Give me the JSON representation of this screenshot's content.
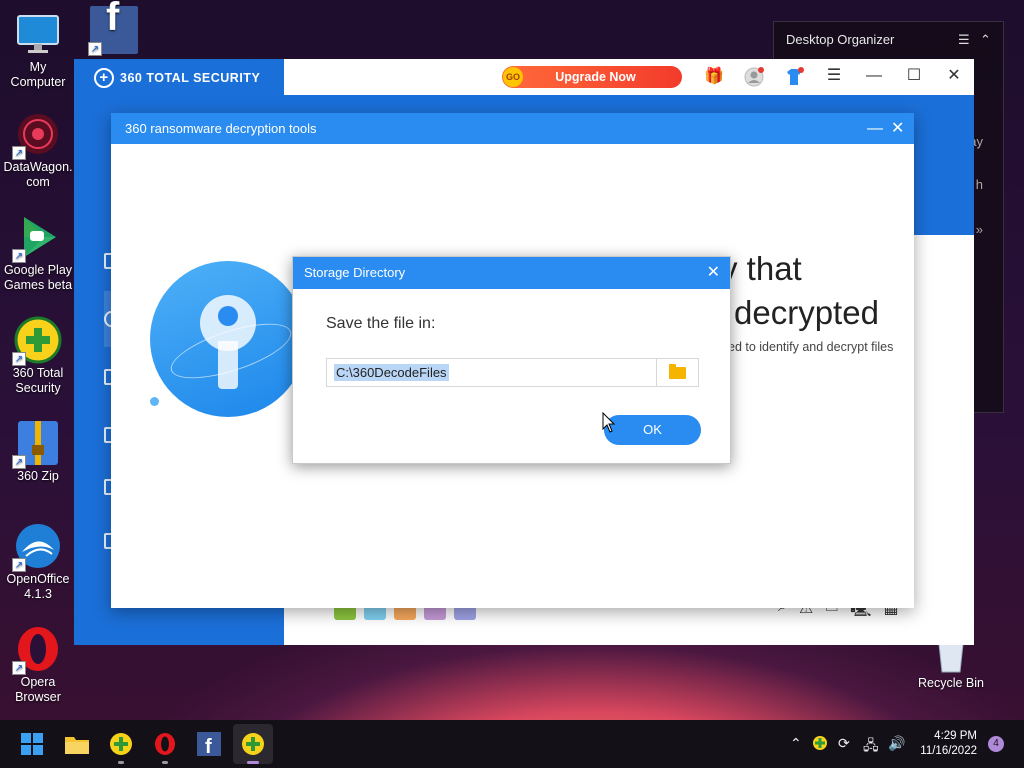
{
  "desktop": {
    "icons": [
      {
        "label": "My\nComputer"
      },
      {
        "label": "DataWagon.\ncom"
      },
      {
        "label": "Google Play\nGames beta"
      },
      {
        "label": "360 Total\nSecurity"
      },
      {
        "label": "360 Zip"
      },
      {
        "label": "OpenOffice\n4.1.3"
      },
      {
        "label": "Opera\nBrowser"
      },
      {
        "label": "Recycle Bin"
      }
    ]
  },
  "organizer": {
    "title": "Desktop Organizer",
    "frag1": "ay",
    "frag2": "h"
  },
  "main_window": {
    "brand": "360 TOTAL SECURITY",
    "upgrade_go": "GO",
    "upgrade_label": "Upgrade Now"
  },
  "tool_window": {
    "title": "360 ransomware decryption tools",
    "heading_line1": "y that",
    "heading_line2": "decrypted",
    "subtext": "ed to identify and decrypt files"
  },
  "dialog": {
    "title": "Storage Directory",
    "label": "Save the file in:",
    "path": "C:\\360DecodeFiles",
    "ok_label": "OK"
  },
  "taskbar": {
    "time": "4:29 PM",
    "date": "11/16/2022",
    "notifications": "4"
  }
}
